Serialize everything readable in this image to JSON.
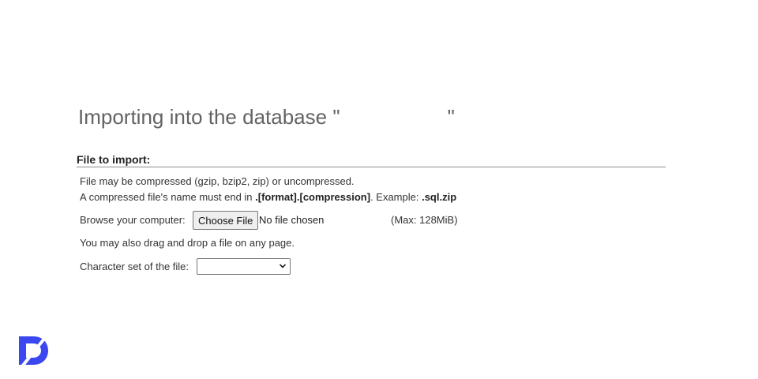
{
  "page": {
    "title_prefix": "Importing into the database \"",
    "title_db_name": "",
    "title_suffix": "\""
  },
  "file_section": {
    "heading": "File to import:",
    "compression_note": "File may be compressed (gzip, bzip2, zip) or uncompressed.",
    "name_note_prefix": "A compressed file's name must end in ",
    "name_note_format": ".[format].[compression]",
    "name_note_example_label": ". Example: ",
    "name_note_example": ".sql.zip",
    "browse_label": "Browse your computer:",
    "choose_button": "Choose File",
    "file_status": "No file chosen",
    "max_size": "(Max: 128MiB)",
    "drag_note": "You may also drag and drop a file on any page.",
    "charset_label": "Character set of the file:",
    "charset_value": ""
  },
  "icons": {
    "dropdown": "chevron-down-icon",
    "logo": "brand-logo-icon"
  },
  "colors": {
    "title": "#636363",
    "text": "#333333",
    "rule": "#8a8a8a",
    "button_bg": "#efefef",
    "logo": "#3b47f0"
  }
}
